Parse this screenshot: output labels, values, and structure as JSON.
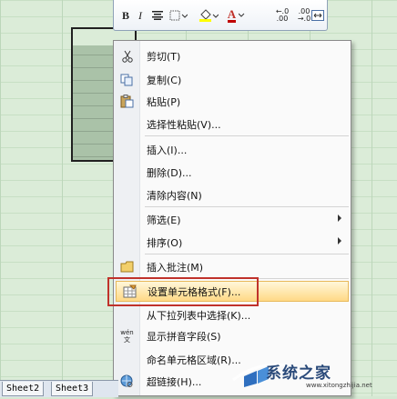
{
  "toolbar": {
    "bold": "B",
    "italic": "I",
    "font_color_letter": "A",
    "increase_decimal": "←.0 .00",
    "decrease_decimal": ".00 →.0"
  },
  "context_menu": {
    "items": [
      {
        "label": "剪切(T)",
        "icon": "scissors-icon"
      },
      {
        "label": "复制(C)",
        "icon": "copy-icon"
      },
      {
        "label": "粘贴(P)",
        "icon": "paste-icon"
      },
      {
        "label": "选择性粘贴(V)..."
      },
      {
        "label": "插入(I)..."
      },
      {
        "label": "删除(D)..."
      },
      {
        "label": "清除内容(N)"
      },
      {
        "label": "筛选(E)",
        "submenu": true
      },
      {
        "label": "排序(O)",
        "submenu": true
      },
      {
        "label": "插入批注(M)",
        "icon": "comment-icon"
      },
      {
        "label": "设置单元格格式(F)...",
        "icon": "format-cells-icon",
        "highlighted": true
      },
      {
        "label": "从下拉列表中选择(K)..."
      },
      {
        "label": "显示拼音字段(S)",
        "icon": "phonetic-icon",
        "icon_text": "wén 文"
      },
      {
        "label": "命名单元格区域(R)..."
      },
      {
        "label": "超链接(H)...",
        "icon": "hyperlink-icon"
      }
    ]
  },
  "sheet_tabs": [
    "Sheet2",
    "Sheet3"
  ],
  "watermark": {
    "text": "系统之家",
    "url": "www.xitongzhijia.net"
  },
  "colors": {
    "highlight": "#ffd986",
    "callout": "#c0322b",
    "font_color_bar": "#c00000",
    "fill_color_bar": "#ffff00"
  }
}
